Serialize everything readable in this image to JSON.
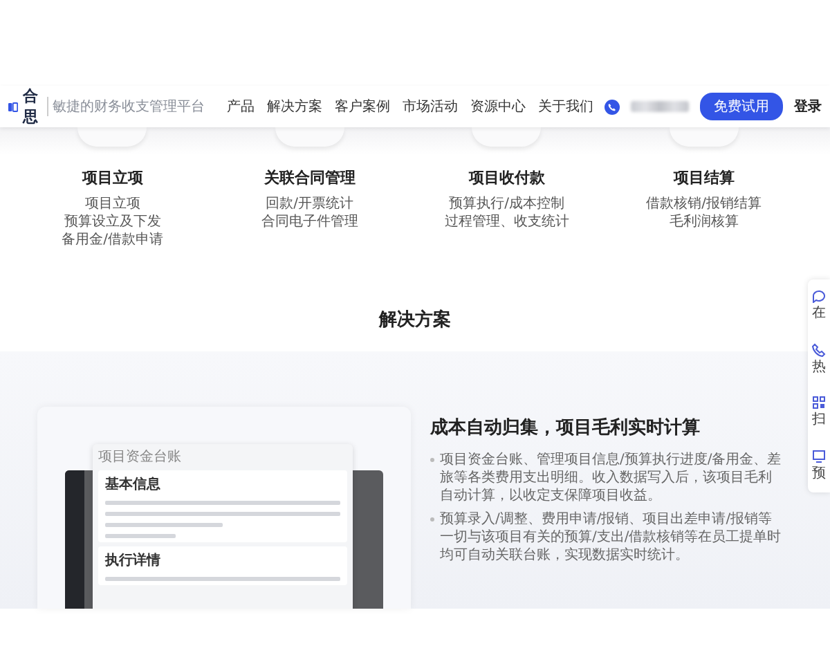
{
  "nav": {
    "logo": "合思",
    "tagline": "敏捷的财务收支管理平台",
    "links": [
      "产品",
      "解决方案",
      "客户案例",
      "市场活动",
      "资源中心",
      "关于我们"
    ],
    "cta": "免费试用",
    "login": "登录"
  },
  "features": [
    {
      "title": "项目立项",
      "items": [
        "项目立项",
        "预算设立及下发",
        "备用金/借款申请"
      ]
    },
    {
      "title": "关联合同管理",
      "items": [
        "回款/开票统计",
        "合同电子件管理"
      ]
    },
    {
      "title": "项目收付款",
      "items": [
        "预算执行/成本控制",
        "过程管理、收支统计"
      ]
    },
    {
      "title": "项目结算",
      "items": [
        "借款核销/报销结算",
        "毛利润核算"
      ]
    }
  ],
  "section_title": "解决方案",
  "solution": {
    "mock": {
      "title": "项目资金台账",
      "sections": [
        "基本信息",
        "执行详情"
      ]
    },
    "heading": "成本自动归集，项目毛利实时计算",
    "bullets": [
      "项目资金台账、管理项目信息/预算执行进度/备用金、差旅等各类费用支出明细。收入数据写入后，该项目毛利自动计算，以收定支保障项目收益。",
      "预算录入/调整、费用申请/报销、项目出差申请/报销等一切与该项目有关的预算/支出/借款核销等在员工提单时均可自动关联台账，实现数据实时统计。"
    ]
  },
  "side_tools": [
    "在",
    "热",
    "扫",
    "预"
  ]
}
